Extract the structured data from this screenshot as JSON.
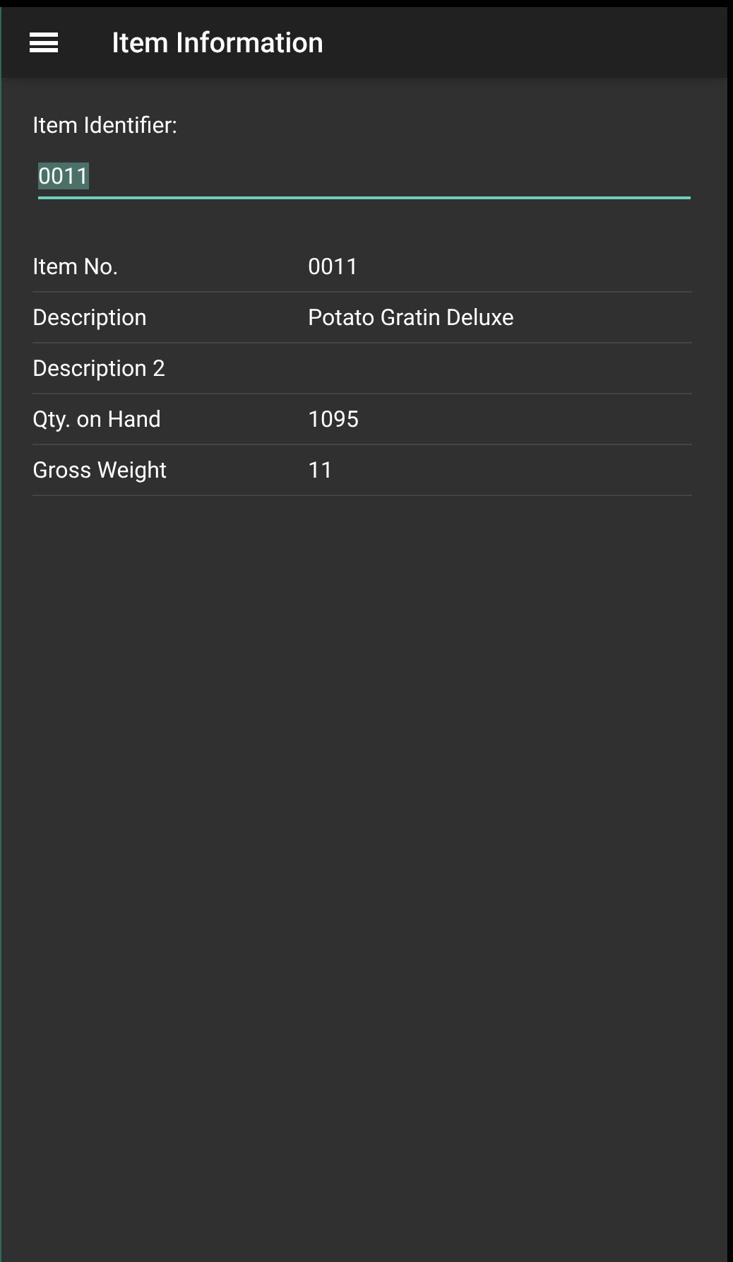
{
  "app_bar": {
    "title": "Item Information"
  },
  "identifier": {
    "label": "Item Identifier:",
    "value": "0011",
    "text_selected": true
  },
  "details": [
    {
      "label": "Item No.",
      "value": "0011"
    },
    {
      "label": "Description",
      "value": "Potato Gratin Deluxe"
    },
    {
      "label": "Description 2"
    },
    {
      "label": "Qty. on Hand",
      "value": "1095"
    },
    {
      "label": "Gross Weight",
      "value": "11"
    }
  ]
}
